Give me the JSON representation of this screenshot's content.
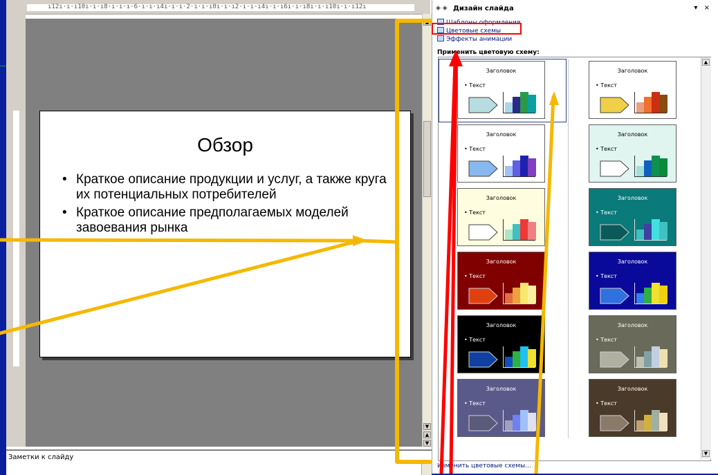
{
  "ruler": {
    "text": "ı12ı·ı·ı10ı·ı·ı8·ı·ı·ı·6·ı·ı·ı4ı·ı·ı·2·ı·ı·ı0ı·ı·ı2·ı·ı·ı4ı·ı·ı6ı·ı·ı8ı·ı·ı10ı·ı·ı12ı"
  },
  "slide": {
    "title": "Обзор",
    "bullets": [
      "Краткое описание продукции и услуг, а также круга их потенциальных потребителей",
      "Краткое описание предполагаемых моделей завоевания рынка"
    ]
  },
  "notes": {
    "label": "Заметки к слайду"
  },
  "pane": {
    "title": "Дизайн слайда",
    "nav_symbols": "◈ ◈",
    "close_symbols": "▾ ×",
    "links": [
      {
        "label": "Шаблоны оформления",
        "icon": "design-template-icon"
      },
      {
        "label": "Цветовые схемы",
        "icon": "color-scheme-icon"
      },
      {
        "label": "Эффекты анимации",
        "icon": "animation-effects-icon"
      }
    ],
    "section_label": "Применить цветовую схему:",
    "bottom_link": "Изменить цветовые схемы...",
    "schemes": [
      {
        "title": "Заголовок",
        "text": "Текст",
        "bg": "#ffffff",
        "fg": "#000000",
        "arrow": "#b8dde0",
        "bars": [
          "#a8d8e8",
          "#2a2a8a",
          "#2a9a4a",
          "#0aa0a0"
        ],
        "heights": [
          0.5,
          0.75,
          1.0,
          0.85
        ]
      },
      {
        "title": "Заголовок",
        "text": "Текст",
        "bg": "#ffffff",
        "fg": "#000000",
        "arrow": "#f0d048",
        "bars": [
          "#e8a080",
          "#f07030",
          "#c83010",
          "#8a4a10"
        ],
        "heights": [
          0.5,
          0.75,
          1.0,
          0.85
        ]
      },
      {
        "title": "Заголовок",
        "text": "Текст",
        "bg": "#ffffff",
        "fg": "#000000",
        "arrow": "#88b8f0",
        "bars": [
          "#a0c0f8",
          "#6060e0",
          "#2020b0",
          "#8040c0"
        ],
        "heights": [
          0.5,
          0.75,
          1.0,
          0.85
        ]
      },
      {
        "title": "Заголовок",
        "text": "Текст",
        "bg": "#e0f4f0",
        "fg": "#000000",
        "arrow": "#ffffff",
        "bars": [
          "#a0e0d8",
          "#1060c0",
          "#109050",
          "#0a8a3a"
        ],
        "heights": [
          0.5,
          0.75,
          1.0,
          0.85
        ]
      },
      {
        "title": "Заголовок",
        "text": "Текст",
        "bg": "#fffde0",
        "fg": "#000000",
        "arrow": "#ffffff",
        "bars": [
          "#a8e8c8",
          "#40c0c0",
          "#f03838",
          "#f08080"
        ],
        "heights": [
          0.5,
          0.75,
          1.0,
          0.85
        ]
      },
      {
        "title": "Заголовок",
        "text": "Текст",
        "bg": "#0a7a7a",
        "fg": "#ffffff",
        "arrow": "#0a5a5a",
        "bars": [
          "#40c0c0",
          "#4040a0",
          "#40e0e0",
          "#40c0c0"
        ],
        "heights": [
          0.5,
          0.75,
          1.0,
          0.85
        ]
      },
      {
        "title": "Заголовок",
        "text": "Текст",
        "bg": "#800000",
        "fg": "#ffffff",
        "arrow": "#e04010",
        "bars": [
          "#e07040",
          "#f0a040",
          "#f8e870",
          "#f8f0a0"
        ],
        "heights": [
          0.5,
          0.75,
          1.0,
          0.85
        ]
      },
      {
        "title": "Заголовок",
        "text": "Текст",
        "bg": "#0a0a9a",
        "fg": "#ffffff",
        "arrow": "#3070e0",
        "bars": [
          "#3080f0",
          "#30b040",
          "#f0e030",
          "#f0d010"
        ],
        "heights": [
          0.5,
          0.75,
          1.0,
          0.85
        ]
      },
      {
        "title": "Заголовок",
        "text": "Текст",
        "bg": "#000000",
        "fg": "#ffffff",
        "arrow": "#1040a0",
        "bars": [
          "#1050c0",
          "#30b040",
          "#20c0f0",
          "#f0e030"
        ],
        "heights": [
          0.5,
          0.75,
          1.0,
          0.85
        ]
      },
      {
        "title": "Заголовок",
        "text": "Текст",
        "bg": "#6a6a5a",
        "fg": "#ffffff",
        "arrow": "#b0b0a0",
        "bars": [
          "#c0c0b0",
          "#80a0a8",
          "#c0d0e0",
          "#f0e0b0"
        ],
        "heights": [
          0.5,
          0.75,
          1.0,
          0.85
        ]
      },
      {
        "title": "Заголовок",
        "text": "Текст",
        "bg": "#5a5a8a",
        "fg": "#ffffff",
        "arrow": "#5a5a7a",
        "bars": [
          "#a0a0c0",
          "#7080f0",
          "#a0c0f8",
          "#e0e0f0"
        ],
        "heights": [
          0.5,
          0.75,
          1.0,
          0.85
        ]
      },
      {
        "title": "Заголовок",
        "text": "Текст",
        "bg": "#4a3a2a",
        "fg": "#ffffff",
        "arrow": "#8a7a6a",
        "bars": [
          "#c0a070",
          "#d0b040",
          "#a0b0a0",
          "#f0e0c0"
        ],
        "heights": [
          0.5,
          0.75,
          1.0,
          0.85
        ]
      }
    ]
  },
  "colors": {
    "annotation_yellow": "#f5b800",
    "annotation_red": "#ff0000",
    "desktop_blue": "#0a1f9e"
  }
}
